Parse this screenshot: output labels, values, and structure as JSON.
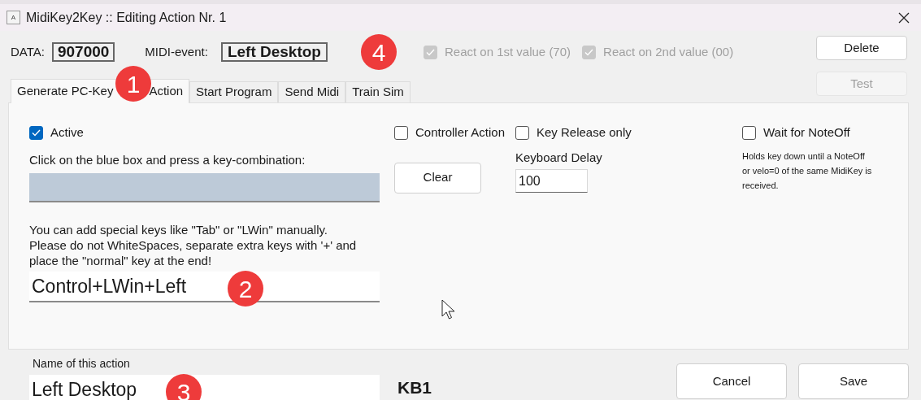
{
  "window": {
    "title": "MidiKey2Key :: Editing Action Nr. 1",
    "app_icon": "A"
  },
  "header": {
    "data_label": "DATA:",
    "data_value": "907000",
    "event_label": "MIDI-event:",
    "event_value": "Left Desktop",
    "checkboxes": [
      {
        "label": "React on 1st value (70)",
        "checked": true,
        "disabled": true
      },
      {
        "label": "React on 2nd value (00)",
        "checked": true,
        "disabled": true
      }
    ],
    "buttons": [
      {
        "label": "Delete",
        "disabled": false
      },
      {
        "label": "Test",
        "disabled": true
      }
    ]
  },
  "tabs": [
    {
      "label": "Generate PC-Key",
      "label_end": "Action",
      "selected": true
    },
    {
      "label": "Start Program",
      "selected": false
    },
    {
      "label": "Send Midi",
      "selected": false
    },
    {
      "label": "Train Sim",
      "selected": false
    }
  ],
  "panel": {
    "active": {
      "label": "Active",
      "checked": true
    },
    "key_prompt": "Click on the blue box and press a key-combination:",
    "clear_button": "Clear",
    "controller_action": {
      "label": "Controller Action",
      "checked": false
    },
    "key_release_only": {
      "label": "Key Release only",
      "checked": false
    },
    "keyboard_delay": {
      "label": "Keyboard Delay",
      "value": "100"
    },
    "wait_for_noteoff": {
      "label": "Wait for NoteOff",
      "checked": false
    },
    "noteoff_hint": "Holds key down until a NoteOff or velo=0 of the same MidiKey is received.",
    "special_keys_hint": "You can add special keys like \"Tab\" or \"LWin\" manually. Please do not WhiteSpaces, separate extra keys with '+' and place the \"normal\" key at the end!",
    "keys_value": "Control+LWin+Left"
  },
  "footer": {
    "name_label": "Name of this action",
    "name_value": "Left Desktop",
    "code": "KB1",
    "buttons": [
      {
        "label": "Cancel"
      },
      {
        "label": "Save"
      }
    ]
  },
  "callouts": [
    {
      "label": "1"
    },
    {
      "label": "2"
    },
    {
      "label": "3"
    },
    {
      "label": "4"
    }
  ]
}
